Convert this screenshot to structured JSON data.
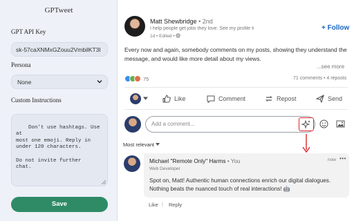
{
  "panel": {
    "title": "GPTweet",
    "api_key_label": "GPT API Key",
    "api_key_value": "sk-57caXNMxGZouu2VmbilKT3l",
    "persona_label": "Persona",
    "persona_selected": "None",
    "instructions_label": "Custom Instructions",
    "instructions_value": "Don't use hashtags. Use at\nmost one emoji. Reply in\nunder 120 characters.\n\nDo not invite further\nchat.",
    "save_label": "Save",
    "save_color": "#2e8b66"
  },
  "post": {
    "author": "Matt Shewbridge",
    "degree": "• 2nd",
    "headline": "I help people get jobs they love. See my profile for ...",
    "meta": "1d • Edited •",
    "follow_label": "+ Follow",
    "text": "Every now and again, somebody comments on my posts, showing they understand the message, and would like more detail about my views.",
    "see_more": "...see more",
    "reaction_count": "75",
    "stats": "71 comments • 4 reposts",
    "actions": {
      "like": "Like",
      "comment": "Comment",
      "repost": "Repost",
      "send": "Send"
    },
    "comment_placeholder": "Add a comment...",
    "sort_label": "Most relevant",
    "accent_color": "#1a66c2",
    "highlight_color": "#e0242a"
  },
  "comment": {
    "name": "Michael \"Remote Only\" Harms",
    "you": "• You",
    "role": "Web Developer",
    "time": "now",
    "more": "•••",
    "text": "Spot on, Matt! Authentic human connections enrich our digital dialogues. Nothing beats the nuanced touch of real interactions! 🤖",
    "like": "Like",
    "separator": "|",
    "reply": "Reply"
  }
}
